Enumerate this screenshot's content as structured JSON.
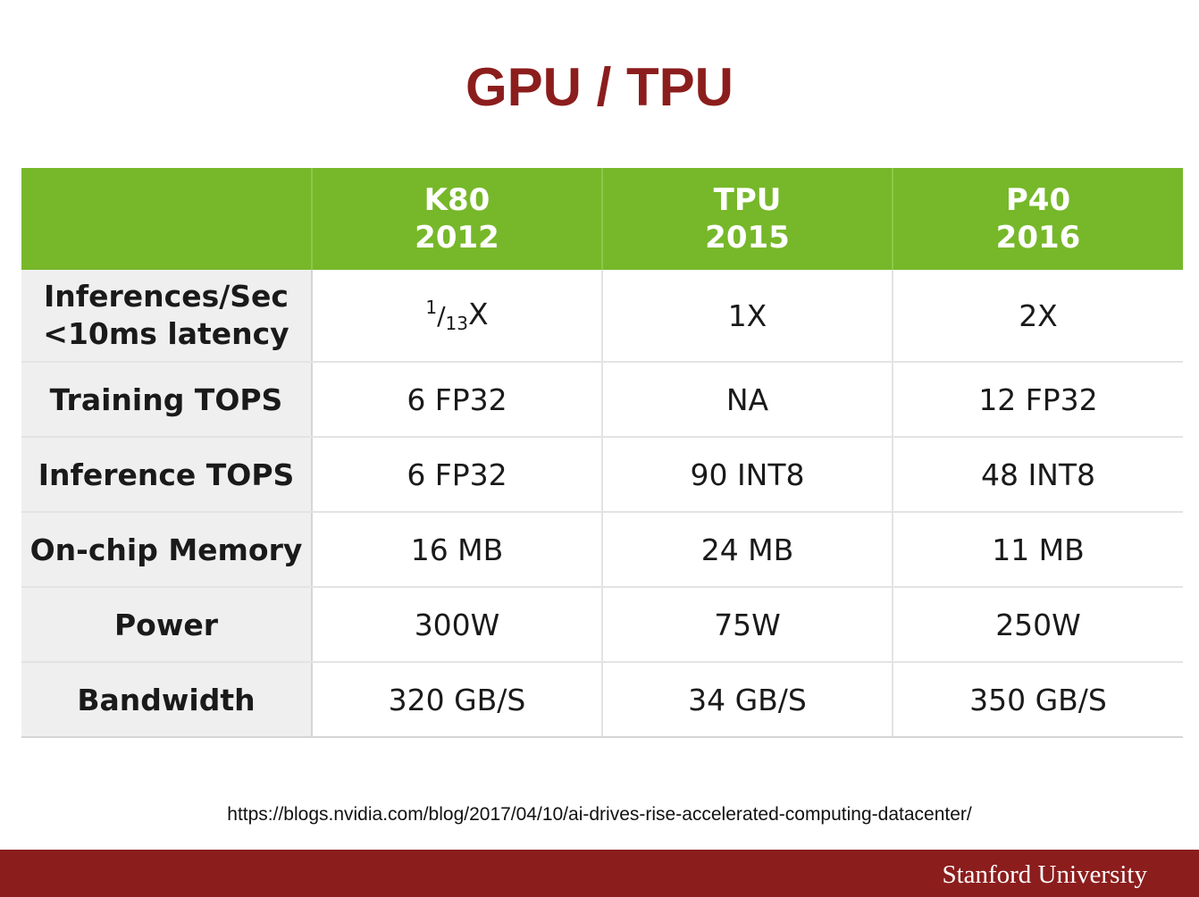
{
  "title": "GPU / TPU",
  "table": {
    "columns": [
      {
        "name": "K80",
        "year": "2012"
      },
      {
        "name": "TPU",
        "year": "2015"
      },
      {
        "name": "P40",
        "year": "2016"
      }
    ],
    "rows": [
      {
        "label_line1": "Inferences/Sec",
        "label_line2": "<10ms latency",
        "k80_num": "1",
        "k80_slash": "/",
        "k80_den": "13",
        "k80_suffix": "X",
        "tpu": "1X",
        "p40": "2X"
      },
      {
        "label": "Training TOPS",
        "values": [
          "6 FP32",
          "NA",
          "12 FP32"
        ]
      },
      {
        "label": "Inference TOPS",
        "values": [
          "6 FP32",
          "90 INT8",
          "48 INT8"
        ]
      },
      {
        "label": "On-chip Memory",
        "values": [
          "16 MB",
          "24 MB",
          "11 MB"
        ]
      },
      {
        "label": "Power",
        "values": [
          "300W",
          "75W",
          "250W"
        ]
      },
      {
        "label": "Bandwidth",
        "values": [
          "320 GB/S",
          "34 GB/S",
          "350 GB/S"
        ]
      }
    ]
  },
  "source_url": "https://blogs.nvidia.com/blog/2017/04/10/ai-drives-rise-accelerated-computing-datacenter/",
  "footer": {
    "institution": "Stanford University"
  },
  "colors": {
    "title": "#8c1d1d",
    "header_green": "#76b82a",
    "footer_bar": "#8c1d1d",
    "label_cell_bg": "#efefef"
  }
}
